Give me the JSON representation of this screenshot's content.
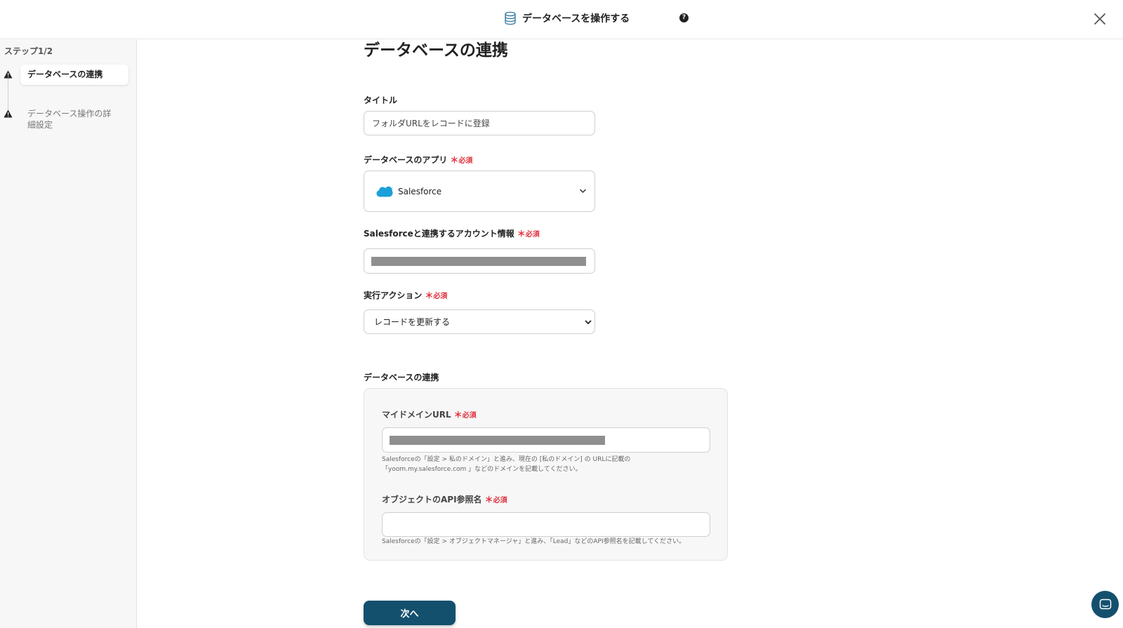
{
  "header": {
    "title": "データベースを操作する",
    "db_icon": "database-icon",
    "help_icon": "question-icon",
    "help_glyph": "?",
    "close_icon": "close-icon"
  },
  "sidebar": {
    "step_indicator": "ステップ1/2",
    "steps": [
      {
        "label": "データベースの連携",
        "status_icon": "warning-icon",
        "active": true
      },
      {
        "label": "データベース操作の詳細設定",
        "status_icon": "warning-icon",
        "active": false
      }
    ]
  },
  "main": {
    "page_title": "データベースの連携",
    "required_text": "必須",
    "required_mark": "＊",
    "title_field": {
      "label": "タイトル",
      "value": "フォルダURLをレコードに登録"
    },
    "app_field": {
      "label": "データベースのアプリ",
      "value": "Salesforce",
      "icon": "salesforce-cloud-icon"
    },
    "account_field": {
      "label": "Salesforceと連携するアカウント情報",
      "value_masked": true
    },
    "action_field": {
      "label": "実行アクション",
      "value": "レコードを更新する"
    },
    "section_title": "データベースの連携",
    "domain_field": {
      "label": "マイドメインURL",
      "value_masked": true,
      "hint_line1": "Salesforceの「設定 > 私のドメイン」と進み、現在の [私のドメイン] の URLに記載の",
      "hint_line2": "「yoom.my.salesforce.com 」などのドメインを記載してください。"
    },
    "object_field": {
      "label": "オブジェクトのAPI参照名",
      "value": "",
      "hint": "Salesforceの「設定 > オブジェクトマネージャ」と進み、「Lead」などのAPI参照名を記載してください。"
    },
    "next_button": "次へ"
  },
  "chat": {
    "icon": "chat-icon"
  },
  "colors": {
    "primary": "#13506d",
    "required": "#e0303c",
    "salesforce": "#1ba0d8"
  }
}
